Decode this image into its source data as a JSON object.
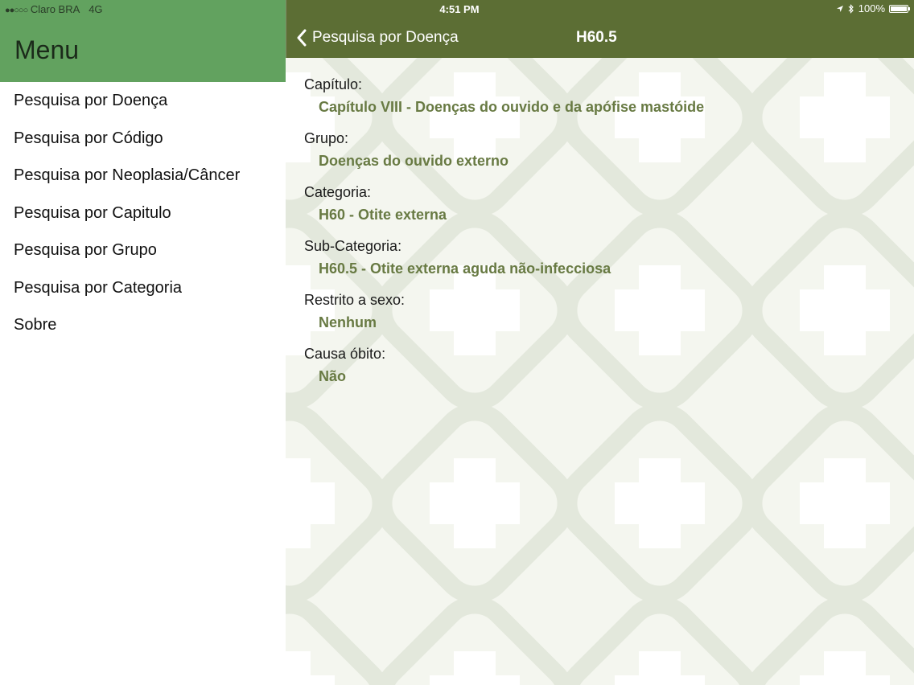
{
  "status_bar": {
    "signal_dots": "●●○○○",
    "carrier": "Claro BRA",
    "network": "4G",
    "time": "4:51 PM",
    "battery": "100%",
    "battery_level": 1.0
  },
  "sidebar": {
    "title": "Menu",
    "items": [
      {
        "label": "Pesquisa por Doença"
      },
      {
        "label": "Pesquisa por Código"
      },
      {
        "label": "Pesquisa por Neoplasia/Câncer"
      },
      {
        "label": "Pesquisa por Capitulo"
      },
      {
        "label": "Pesquisa por Grupo"
      },
      {
        "label": "Pesquisa por Categoria"
      },
      {
        "label": "Sobre"
      }
    ]
  },
  "navbar": {
    "back_label": "Pesquisa por Doença",
    "title": "H60.5"
  },
  "details": [
    {
      "label": "Capítulo:",
      "value": "Capítulo VIII - Doenças do ouvido e da apófise mastóide"
    },
    {
      "label": "Grupo:",
      "value": "Doenças do ouvido externo"
    },
    {
      "label": "Categoria:",
      "value": "H60 - Otite externa"
    },
    {
      "label": "Sub-Categoria:",
      "value": "H60.5 - Otite externa aguda não-infecciosa"
    },
    {
      "label": "Restrito a sexo:",
      "value": "Nenhum"
    },
    {
      "label": "Causa óbito:",
      "value": "Não"
    }
  ],
  "colors": {
    "sidebar_header": "#62a25f",
    "navbar": "#5c6e34",
    "value_text": "#687a43",
    "pattern_tile": "#e6ebdf"
  }
}
